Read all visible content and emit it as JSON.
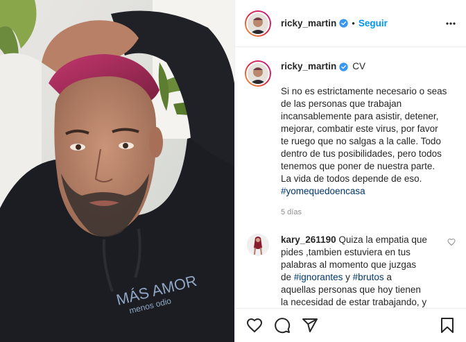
{
  "post": {
    "author": "ricky_martin",
    "follow_label": "Seguir",
    "dot": "•",
    "caption_suffix": "CV",
    "caption_lines": [
      "Si no es estrictamente necesario o seas",
      "de las personas que trabajan",
      "incansablemente para asistir, detener,",
      "mejorar, combatir este virus, por favor",
      "te ruego que no salgas a la calle. Todo",
      "dentro de tus posibilidades, pero todos",
      "tenemos que poner de nuestra parte.",
      "La vida de todos depende de eso."
    ],
    "hashtag": "#yomequedoencasa",
    "timestamp": "5 días"
  },
  "comment": {
    "author": "kary_261190",
    "line1": "Quiza la empatia que",
    "line2": "pides ,tambien estuviera en tus",
    "line3": "palabras al momento que juzgas",
    "line4_pre": "de ",
    "tag1": "#ignorantes",
    "line4_mid": " y ",
    "tag2": "#brutos",
    "line4_post": " a",
    "line5": "aquellas personas que hoy tienen",
    "line6": "la necesidad de estar trabajando, y"
  },
  "photo": {
    "hoodie_text_1": "MÁS AMOR",
    "hoodie_text_2": "menos odio"
  },
  "colors": {
    "accent": "#0095f6",
    "hashtag": "#00376b",
    "verified": "#3897f0"
  },
  "icons": [
    "more-options-icon",
    "verified-icon",
    "heart-icon",
    "comment-icon",
    "share-icon",
    "bookmark-icon"
  ]
}
